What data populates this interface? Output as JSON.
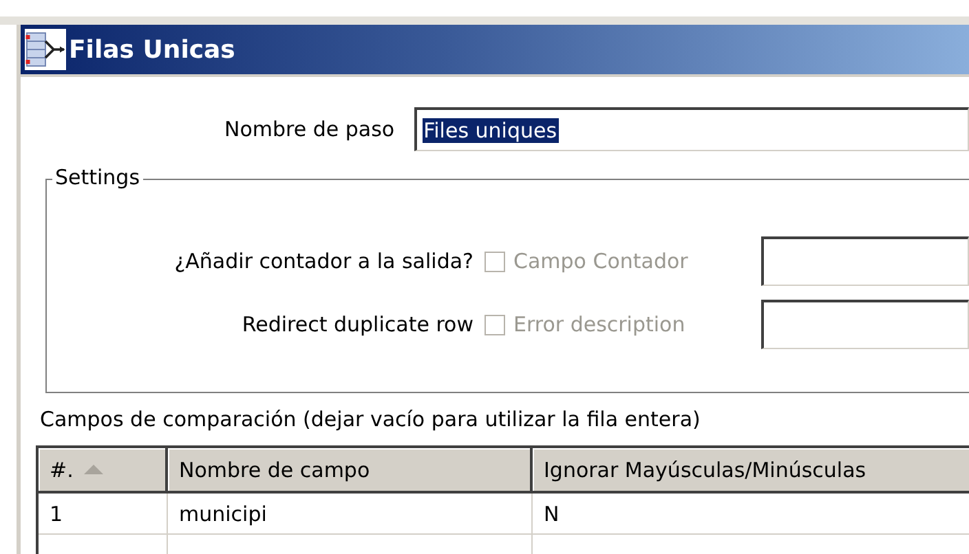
{
  "window": {
    "title": "Filas Unicas"
  },
  "step_name": {
    "label": "Nombre de paso",
    "value": "Files uniques",
    "value_selected": true
  },
  "settings": {
    "title": "Settings",
    "rows": [
      {
        "label": "¿Añadir contador a la salida?",
        "checked": false,
        "field_label": "Campo Contador",
        "disabled": true
      },
      {
        "label": "Redirect duplicate row",
        "checked": false,
        "field_label": "Error description",
        "disabled": true
      }
    ]
  },
  "comparison": {
    "caption": "Campos de comparación (dejar vacío para utilizar la fila entera)",
    "columns": [
      {
        "label": "#.",
        "sorted": true
      },
      {
        "label": "Nombre de campo",
        "sorted": false
      },
      {
        "label": "Ignorar Mayúsculas/Minúsculas",
        "sorted": false
      }
    ],
    "rows": [
      [
        "1",
        "municipi",
        "N"
      ]
    ]
  }
}
